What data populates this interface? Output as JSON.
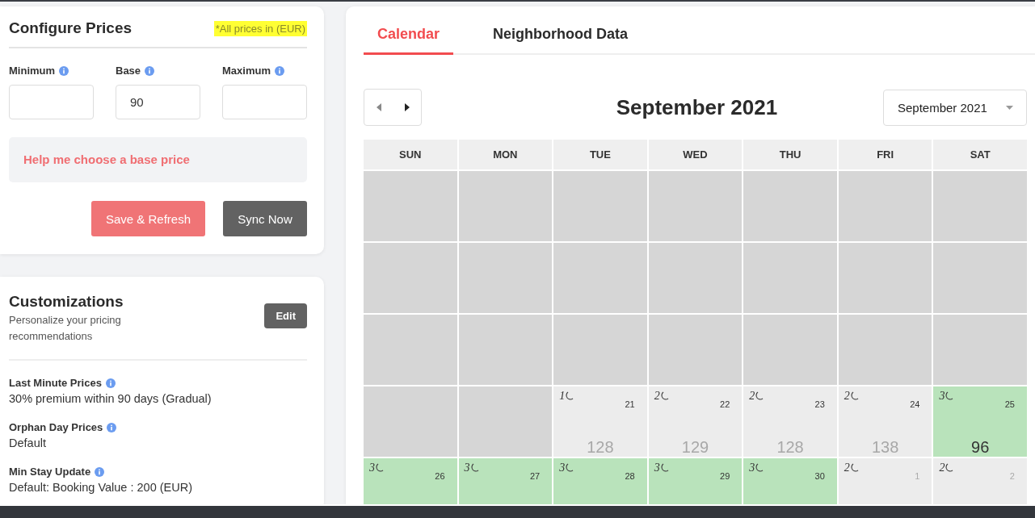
{
  "configure": {
    "title": "Configure Prices",
    "note": "*All prices in (EUR)",
    "note_highlighted": true,
    "fields": [
      {
        "label": "Minimum"
      },
      {
        "label": "Base",
        "value": "90"
      },
      {
        "label": "Maximum"
      }
    ],
    "help_link": "Help me choose a base price",
    "buttons": [
      {
        "label": "Save & Refresh",
        "kind": "primary"
      },
      {
        "label": "Sync Now",
        "kind": "secondary"
      }
    ]
  },
  "customizations": {
    "title": "Customizations",
    "subtitle": "Personalize your pricing recommendations",
    "edit_button": "Edit",
    "items": [
      {
        "label": "Last Minute Prices",
        "value": "30% premium within 90 days (Gradual)"
      },
      {
        "label": "Orphan Day Prices",
        "value": "Default"
      },
      {
        "label": "Min Stay Update",
        "value": "Default: Booking Value : 200 (EUR)"
      }
    ]
  },
  "tabs": [
    {
      "label": "Calendar",
      "selected": true
    },
    {
      "label": "Neighborhood Data",
      "selected": false
    }
  ],
  "calendar": {
    "title": "September 2021",
    "month_select": "September 2021",
    "weekdays": [
      "SUN",
      "MON",
      "TUE",
      "WED",
      "THU",
      "FRI",
      "SAT"
    ],
    "days": [
      {
        "kind": "past"
      },
      {
        "kind": "past"
      },
      {
        "kind": "past"
      },
      {
        "kind": "past"
      },
      {
        "kind": "past"
      },
      {
        "kind": "past"
      },
      {
        "kind": "past"
      },
      {
        "kind": "past"
      },
      {
        "kind": "past"
      },
      {
        "kind": "past"
      },
      {
        "kind": "past"
      },
      {
        "kind": "past"
      },
      {
        "kind": "past"
      },
      {
        "kind": "past"
      },
      {
        "kind": "past"
      },
      {
        "kind": "past"
      },
      {
        "kind": "past"
      },
      {
        "kind": "past"
      },
      {
        "kind": "past"
      },
      {
        "kind": "past"
      },
      {
        "kind": "past"
      },
      {
        "kind": "past"
      },
      {
        "kind": "past"
      },
      {
        "kind": "open",
        "nights": "1",
        "day": "21",
        "price": "128"
      },
      {
        "kind": "open",
        "nights": "2",
        "day": "22",
        "price": "129"
      },
      {
        "kind": "open",
        "nights": "2",
        "day": "23",
        "price": "128"
      },
      {
        "kind": "open",
        "nights": "2",
        "day": "24",
        "price": "138"
      },
      {
        "kind": "booked",
        "nights": "3",
        "day": "25",
        "price": "96"
      },
      {
        "kind": "booked",
        "nights": "3",
        "day": "26"
      },
      {
        "kind": "booked",
        "nights": "3",
        "day": "27"
      },
      {
        "kind": "booked",
        "nights": "3",
        "day": "28"
      },
      {
        "kind": "booked",
        "nights": "3",
        "day": "29"
      },
      {
        "kind": "booked",
        "nights": "3",
        "day": "30"
      },
      {
        "kind": "other",
        "nights": "2",
        "day": "1"
      },
      {
        "kind": "other",
        "nights": "2",
        "day": "2"
      }
    ]
  }
}
